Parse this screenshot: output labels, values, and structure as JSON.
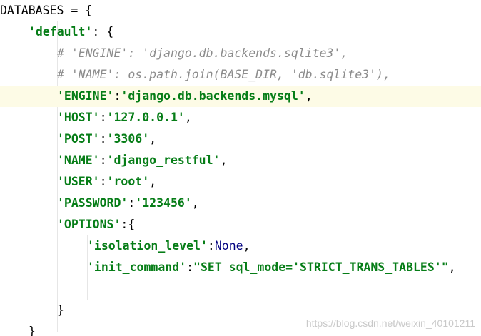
{
  "editor": {
    "highlighted_line_index": 4,
    "lines": [
      {
        "tokens": [
          {
            "t": "plain",
            "v": "DATABASES = {"
          }
        ]
      },
      {
        "tokens": [
          {
            "t": "str",
            "v": "'default'"
          },
          {
            "t": "plain",
            "v": ": {"
          }
        ]
      },
      {
        "tokens": [
          {
            "t": "cmt",
            "v": "# 'ENGINE': 'django.db.backends.sqlite3',"
          }
        ]
      },
      {
        "tokens": [
          {
            "t": "cmt",
            "v": "# 'NAME': os.path.join(BASE_DIR, 'db.sqlite3'),"
          }
        ]
      },
      {
        "tokens": [
          {
            "t": "str",
            "v": "'ENGINE'"
          },
          {
            "t": "plain",
            "v": ":"
          },
          {
            "t": "str",
            "v": "'django.db.backends.mysql'"
          },
          {
            "t": "plain",
            "v": ","
          }
        ]
      },
      {
        "tokens": [
          {
            "t": "str",
            "v": "'HOST'"
          },
          {
            "t": "plain",
            "v": ":"
          },
          {
            "t": "str",
            "v": "'127.0.0.1'"
          },
          {
            "t": "plain",
            "v": ","
          }
        ]
      },
      {
        "tokens": [
          {
            "t": "str",
            "v": "'POST'"
          },
          {
            "t": "plain",
            "v": ":"
          },
          {
            "t": "str",
            "v": "'3306'"
          },
          {
            "t": "plain",
            "v": ","
          }
        ]
      },
      {
        "tokens": [
          {
            "t": "str",
            "v": "'NAME'"
          },
          {
            "t": "plain",
            "v": ":"
          },
          {
            "t": "str",
            "v": "'django_restful'"
          },
          {
            "t": "plain",
            "v": ","
          }
        ]
      },
      {
        "tokens": [
          {
            "t": "str",
            "v": "'USER'"
          },
          {
            "t": "plain",
            "v": ":"
          },
          {
            "t": "str",
            "v": "'root'"
          },
          {
            "t": "plain",
            "v": ","
          }
        ]
      },
      {
        "tokens": [
          {
            "t": "str",
            "v": "'PASSWORD'"
          },
          {
            "t": "plain",
            "v": ":"
          },
          {
            "t": "str",
            "v": "'123456'"
          },
          {
            "t": "plain",
            "v": ","
          }
        ]
      },
      {
        "tokens": [
          {
            "t": "str",
            "v": "'OPTIONS'"
          },
          {
            "t": "plain",
            "v": ":{"
          }
        ]
      },
      {
        "tokens": [
          {
            "t": "str",
            "v": "'isolation_level'"
          },
          {
            "t": "plain",
            "v": ":"
          },
          {
            "t": "kw",
            "v": "None"
          },
          {
            "t": "plain",
            "v": ","
          }
        ]
      },
      {
        "tokens": [
          {
            "t": "str",
            "v": "'init_command'"
          },
          {
            "t": "plain",
            "v": ":"
          },
          {
            "t": "str",
            "v": "\"SET sql_mode='STRICT_TRANS_TABLES'\""
          },
          {
            "t": "plain",
            "v": ","
          }
        ]
      },
      {
        "tokens": []
      },
      {
        "tokens": [
          {
            "t": "plain",
            "v": "}"
          }
        ]
      },
      {
        "tokens": [
          {
            "t": "plain",
            "v": "}"
          }
        ]
      }
    ]
  },
  "watermark": "https://blog.csdn.net/weixin_40101211",
  "colors": {
    "string": "#067d17",
    "comment": "#8c8c8c",
    "keyword": "#000080",
    "current_line_bg": "#fdfbe6",
    "indent_guide": "#e6e6e6"
  }
}
